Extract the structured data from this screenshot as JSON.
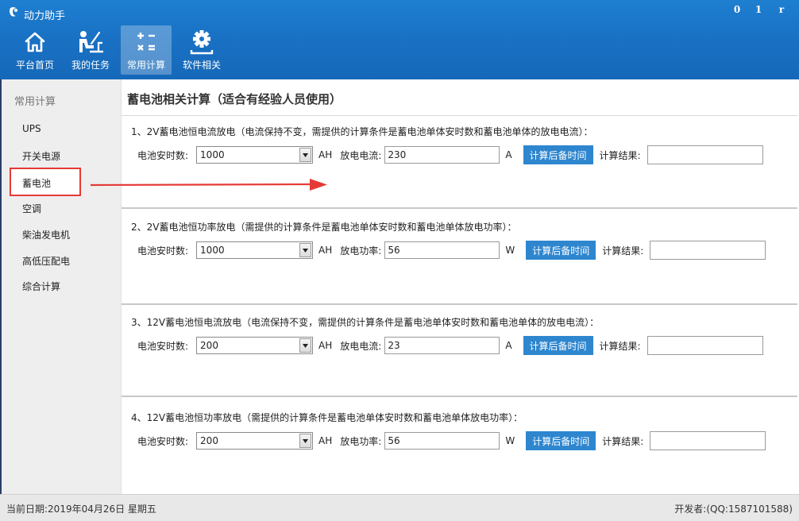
{
  "window": {
    "title": "动力助手",
    "controls": {
      "minimize": "0",
      "maximize": "1",
      "close": "r"
    }
  },
  "nav": {
    "items": [
      {
        "label": "平台首页",
        "icon": "home-icon"
      },
      {
        "label": "我的任务",
        "icon": "person-desk-icon"
      },
      {
        "label": "常用计算",
        "icon": "calculator-icon",
        "active": true
      },
      {
        "label": "软件相关",
        "icon": "gear-icon"
      }
    ]
  },
  "sidebar": {
    "header": "常用计算",
    "items": [
      {
        "label": "UPS"
      },
      {
        "label": "开关电源"
      },
      {
        "label": "蓄电池",
        "active": true
      },
      {
        "label": "空调"
      },
      {
        "label": "柴油发电机"
      },
      {
        "label": "高低压配电"
      },
      {
        "label": "综合计算"
      }
    ]
  },
  "main": {
    "title": "蓄电池相关计算（适合有经验人员使用）",
    "sections": [
      {
        "title": "1、2V蓄电池恒电流放电（电流保持不变，需提供的计算条件是蓄电池单体安时数和蓄电池单体的放电电流）：",
        "capacity_label": "电池安时数:",
        "capacity_value": "1000",
        "capacity_unit": "AH",
        "param_label": "放电电流:",
        "param_value": "230",
        "param_unit": "A",
        "button": "计算后备时间",
        "result_label": "计算结果:",
        "result_value": ""
      },
      {
        "title": "2、2V蓄电池恒功率放电（需提供的计算条件是蓄电池单体安时数和蓄电池单体放电功率）：",
        "capacity_label": "电池安时数:",
        "capacity_value": "1000",
        "capacity_unit": "AH",
        "param_label": "放电功率:",
        "param_value": "56",
        "param_unit": "W",
        "button": "计算后备时间",
        "result_label": "计算结果:",
        "result_value": ""
      },
      {
        "title": "3、12V蓄电池恒电流放电（电流保持不变，需提供的计算条件是蓄电池单体安时数和蓄电池单体的放电电流）：",
        "capacity_label": "电池安时数:",
        "capacity_value": "200",
        "capacity_unit": "AH",
        "param_label": "放电电流:",
        "param_value": "23",
        "param_unit": "A",
        "button": "计算后备时间",
        "result_label": "计算结果:",
        "result_value": ""
      },
      {
        "title": "4、12V蓄电池恒功率放电（需提供的计算条件是蓄电池单体安时数和蓄电池单体放电功率）：",
        "capacity_label": "电池安时数:",
        "capacity_value": "200",
        "capacity_unit": "AH",
        "param_label": "放电功率:",
        "param_value": "56",
        "param_unit": "W",
        "button": "计算后备时间",
        "result_label": "计算结果:",
        "result_value": ""
      }
    ]
  },
  "status": {
    "date": "当前日期:2019年04月26日 星期五",
    "developer": "开发者:(QQ:1587101588)"
  },
  "colors": {
    "header": "#1a73c6",
    "button": "#2e86cf",
    "highlight_border": "#e53935",
    "annotation_arrow": "#e53935"
  }
}
